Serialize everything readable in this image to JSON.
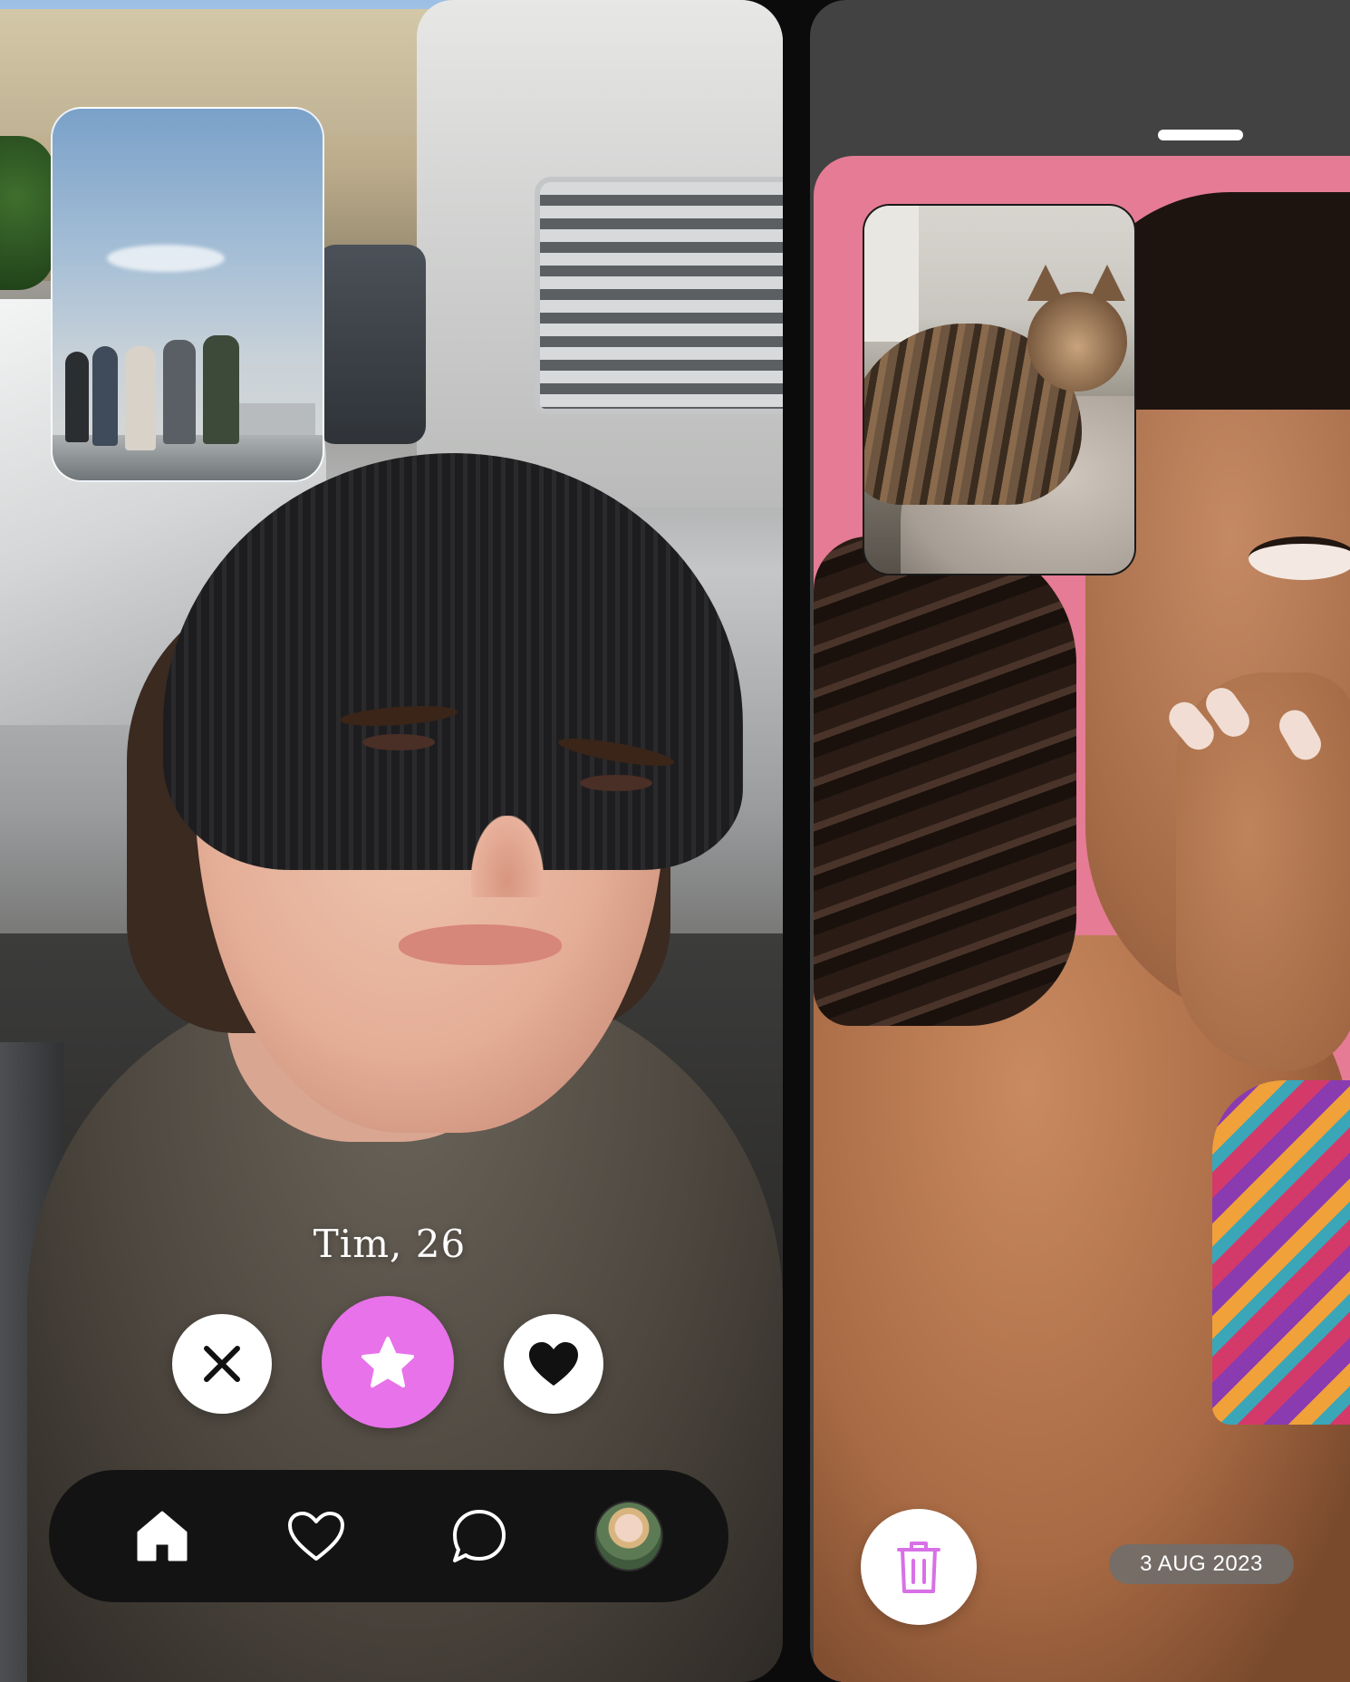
{
  "left_profile": {
    "name_age": "Tim, 26",
    "actions": {
      "dislike_icon": "x-icon",
      "superlike_icon": "star-icon",
      "like_icon": "heart-icon"
    }
  },
  "nav": {
    "items": [
      {
        "icon": "home-icon",
        "active": true
      },
      {
        "icon": "heart-outline-icon",
        "active": false
      },
      {
        "icon": "chat-bubble-icon",
        "active": false
      },
      {
        "icon": "avatar",
        "active": false
      }
    ]
  },
  "right_card": {
    "date": "3 AUG 2023",
    "delete_icon": "trash-icon"
  },
  "colors": {
    "accent_pink": "#e872ea",
    "card_bg_pink": "#e57b94",
    "nav_bg": "#131313",
    "right_phone_bg": "#424242"
  }
}
